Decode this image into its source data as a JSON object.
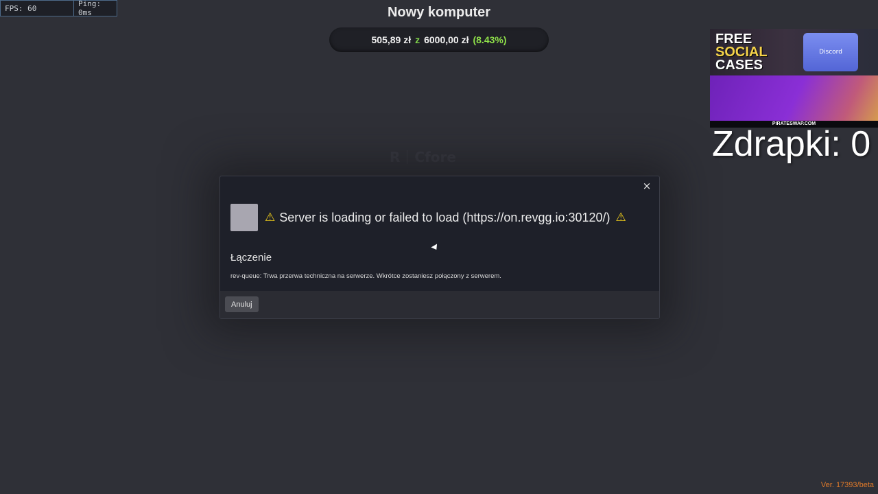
{
  "perf": {
    "fps": "FPS: 60",
    "ping": "Ping: 0ms"
  },
  "goal": {
    "title": "Nowy komputer",
    "current": "505,89 zł",
    "sep": "z",
    "target": "6000,00 zł",
    "percent": "(8.43%)"
  },
  "ad": {
    "title_line1": "FREE",
    "title_line2": "SOCIAL",
    "title_line3": "CASES",
    "case_label": "Discord",
    "site": "PIRATESWAP.COM"
  },
  "scratch_counter": "Zdrapki: 0",
  "background_logos": {
    "left": "R",
    "right": "Cfore"
  },
  "modal": {
    "close_icon": "×",
    "warning_icon": "⚠",
    "title": "Server is loading or failed to load (https://on.revgg.io:30120/)",
    "status_label": "Łączenie",
    "status_message": "rev-queue: Trwa przerwa techniczna na serwerze. Wkrótce zostaniesz połączony z serwerem.",
    "cancel_label": "Anuluj"
  },
  "version": "Ver. 17393/beta",
  "colors": {
    "background": "#2f3037",
    "modal": "#1e2029",
    "warning": "#f2cf1a",
    "percent": "#8fe04a",
    "version": "#e07a2a"
  }
}
